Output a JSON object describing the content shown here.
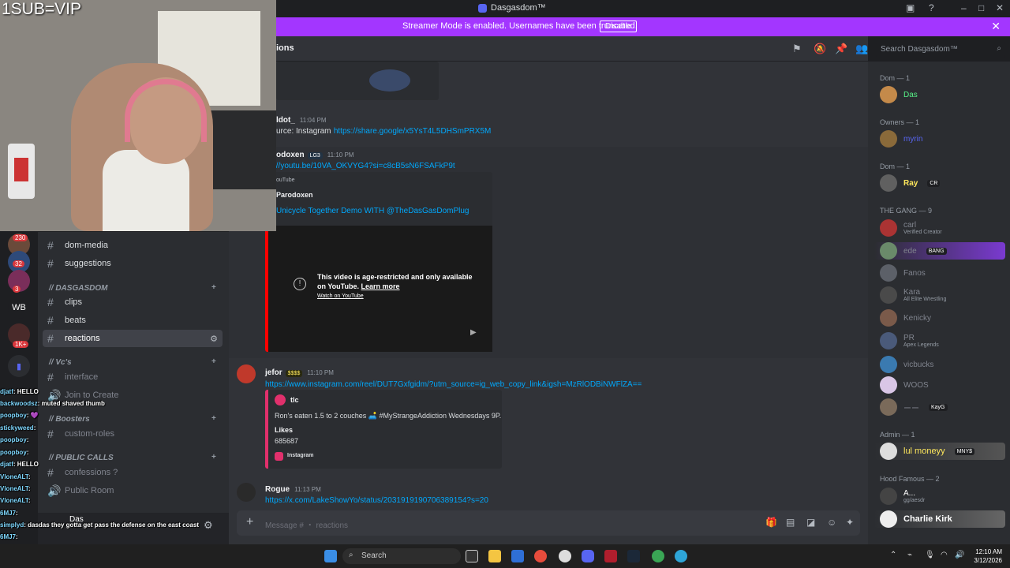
{
  "window": {
    "title": "Dasgasdom™"
  },
  "banner": {
    "text": "Streamer Mode is enabled. Usernames have been truncated.",
    "button": "Disable"
  },
  "header": {
    "channel_name": "ions",
    "search_placeholder": "Search Dasgasdom™"
  },
  "servers": {
    "badges": [
      "230",
      "32",
      "3",
      "1K+"
    ],
    "label_wb": "WB"
  },
  "channels": {
    "items_top": [
      {
        "name": "dom-media"
      },
      {
        "name": "suggestions"
      }
    ],
    "cat_dasgasdom": "// DASGASDOM",
    "items_dasgasdom": [
      {
        "name": "clips"
      },
      {
        "name": "beats"
      },
      {
        "name": "reactions"
      }
    ],
    "cat_vcs": "// Vc's",
    "vc_items": [
      "interface",
      "Join to Create"
    ],
    "cat_boosters": "// Boosters",
    "booster_items": [
      "custom-roles"
    ],
    "cat_public": "// PUBLIC CALLS",
    "public_items": [
      "confessions ?",
      "Public Room"
    ]
  },
  "userbar": {
    "name": "Das"
  },
  "messages": {
    "m1": {
      "user": "ldot_",
      "time": "11:04 PM",
      "prefix": "urce: Instagram",
      "link": "https://share.google/x5YsT4L5DHSmPRX5M"
    },
    "m2": {
      "user": "odoxen",
      "badge": "LG3",
      "time": "11:10 PM",
      "link": "s://youtu.be/10VA_OKVYG4?si=c8cB5sN6FSAFkP9t",
      "embed_provider": "ouTube",
      "embed_author": "Parodoxen",
      "embed_title": "Unicycle Together Demo WITH @TheDasGasDomPlug",
      "age_restricted_1": "This video is age-restricted and only available",
      "age_restricted_2": "on YouTube.",
      "learn_more": "Learn more",
      "watch_on": "Watch on YouTube"
    },
    "m3": {
      "user": "jefor",
      "badge": "$$$$",
      "time": "11:10 PM",
      "link": "https://www.instagram.com/reel/DUT7Gxfgidm/?utm_source=ig_web_copy_link&igsh=MzRlODBiNWFlZA==",
      "embed_author": "tlc",
      "embed_desc": "Ron's eaten 1.5 to 2 couches 🛋️ #MyStrangeAddiction Wednesdays 9P.",
      "likes_label": "Likes",
      "likes_value": "685687",
      "footer": "Instagram"
    },
    "m4": {
      "user": "Rogue",
      "time": "11:13 PM",
      "link": "https://x.com/LakeShowYo/status/2031919190706389154?s=20"
    }
  },
  "composer": {
    "placeholder": "Message # ・ reactions"
  },
  "members": {
    "roles": [
      "Dom — 1",
      "Owners — 1",
      "Dom — 1",
      "THE GANG — 9",
      "Admin — 1",
      "Hood Famous — 2"
    ],
    "list": [
      {
        "name": "Das",
        "color": "#57f287"
      },
      {
        "name": "myrin",
        "color": "#5865f2"
      },
      {
        "name": "Ray",
        "color": "#fee75c",
        "tag": "CR"
      },
      {
        "name": "carl",
        "sub": "Verified Creator"
      },
      {
        "name": "ede",
        "tag": "BANG"
      },
      {
        "name": "Fanos"
      },
      {
        "name": "Kara",
        "sub": "All Elite Wrestling"
      },
      {
        "name": "Kenicky"
      },
      {
        "name": "PR",
        "sub": "Apex Legends"
      },
      {
        "name": "vicbucks"
      },
      {
        "name": "WOOS"
      },
      {
        "name": "ーー",
        "tag": "KayG"
      },
      {
        "name": "lul moneyy",
        "color": "#fee75c",
        "tag": "MNY$"
      },
      {
        "name": "A...",
        "sub": "gg/aesdr"
      },
      {
        "name": "Charlie Kirk",
        "color": "#ffffff"
      }
    ]
  },
  "overlay": {
    "title": "1SUB=VIP",
    "chat": [
      {
        "user": "djatf",
        "msg": ": HELLO"
      },
      {
        "user": "backwoodsz",
        "msg": ": muted shaved thumb"
      },
      {
        "user": "poopboy",
        "msg": ": 💜"
      },
      {
        "user": "stickyweed",
        "msg": ":"
      },
      {
        "user": "poopboy",
        "msg": ":"
      },
      {
        "user": "poopboy",
        "msg": ":"
      },
      {
        "user": "djatf",
        "msg": ": HELLO"
      },
      {
        "user": "VloneALT",
        "msg": ":"
      },
      {
        "user": "VloneALT",
        "msg": ":"
      },
      {
        "user": "VloneALT",
        "msg": ":"
      },
      {
        "user": "6MJ7",
        "msg": ":"
      },
      {
        "user": "simplyd",
        "msg": ": dasdas they gotta get pass the defense on the east coast"
      },
      {
        "user": "6MJ7",
        "msg": ":"
      },
      {
        "user": "6MJ7",
        "msg": ":"
      }
    ]
  },
  "taskbar": {
    "search": "Search",
    "time": "12:10 AM",
    "date": "3/12/2026"
  }
}
